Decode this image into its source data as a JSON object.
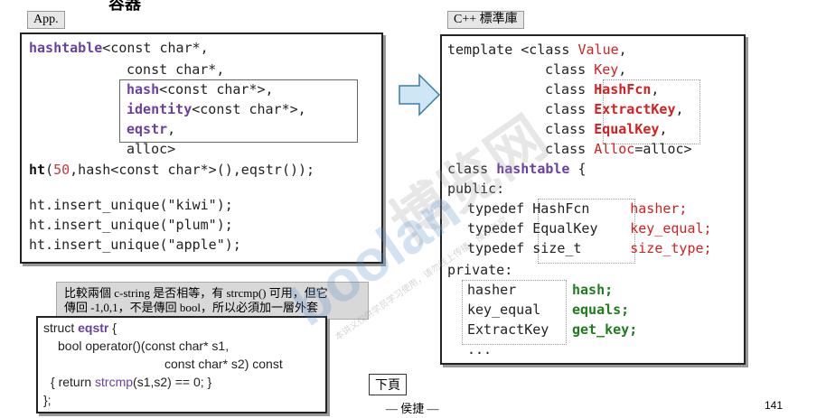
{
  "top_heading": "容器",
  "left_label": "App.",
  "right_label": "C++ 標準庫",
  "app_code": {
    "l1_name": "hashtable",
    "l1_rest": "<const char*,",
    "l2": "const char*,",
    "l3_name": "hash",
    "l3_rest": "<const char*>,",
    "l4_name": "identity",
    "l4_rest": "<const char*>,",
    "l5_name": "eqstr",
    "l5_rest": ",",
    "l6": "alloc>",
    "l7_name": "ht",
    "l7_open": "(",
    "l7_num": "50",
    "l7_rest": ",hash<const char*>(),eqstr());",
    "l8": "ht.insert_unique(\"kiwi\");",
    "l9": "ht.insert_unique(\"plum\");",
    "l10": "ht.insert_unique(\"apple\");"
  },
  "lib_code": {
    "l1_pre": "template <class ",
    "l1_name": "Value",
    "l1_post": ",",
    "l2_pre": "class ",
    "l2_name": "Key",
    "l2_post": ",",
    "l3_pre": "class ",
    "l3_name": "HashFcn",
    "l3_post": ",",
    "l4_pre": "class ",
    "l4_name": "ExtractKey",
    "l4_post": ",",
    "l5_pre": "class ",
    "l5_name": "EqualKey",
    "l5_post": ",",
    "l6_pre": "class ",
    "l6_name": "Alloc",
    "l6_post": "=alloc>",
    "l7_pre": "class ",
    "l7_name": "hashtable",
    "l7_post": " {",
    "l8": "public:",
    "l9_pre": "typedef ",
    "l9_type": "HashFcn",
    "l9_name": "hasher;",
    "l10_pre": "typedef ",
    "l10_type": "EqualKey",
    "l10_name": "key_equal;",
    "l11_pre": "typedef ",
    "l11_type": "size_t",
    "l11_name": "size_type;",
    "l12": "private:",
    "l13_type": "hasher",
    "l13_name": "hash;",
    "l14_type": "key_equal",
    "l14_name": "equals;",
    "l15_type": "ExtractKey",
    "l15_name": "get_key;",
    "l16": "..."
  },
  "note": {
    "line1": "比較兩個 c-string 是否相等，有 strcmp() 可用，但它",
    "line2": "傳回 -1,0,1，不是傳回 bool，所以必須加一層外套"
  },
  "eqstr_code": {
    "l1_pre": "struct ",
    "l1_name": "eqstr",
    "l1_post": " {",
    "l2": "bool operator()(const char* s1,",
    "l3": "const char* s2) const",
    "l4_pre": "{ return ",
    "l4_fn": "strcmp",
    "l4_post": "(s1,s2) == 0; }",
    "l5": "};"
  },
  "next_page_button": "下頁",
  "author": "— 侯捷 —",
  "page_number": "141",
  "watermark": {
    "logo": "boolan",
    "brand": "博览网",
    "notice": "本讲义仅供学员学习使用，请勿线上传播，侵权必究"
  },
  "colors": {
    "purple": "#6b3fa0",
    "red": "#d32020",
    "green": "#1e7b1e",
    "arrow_fill": "#cfe7f5",
    "arrow_stroke": "#3a7ca5"
  }
}
